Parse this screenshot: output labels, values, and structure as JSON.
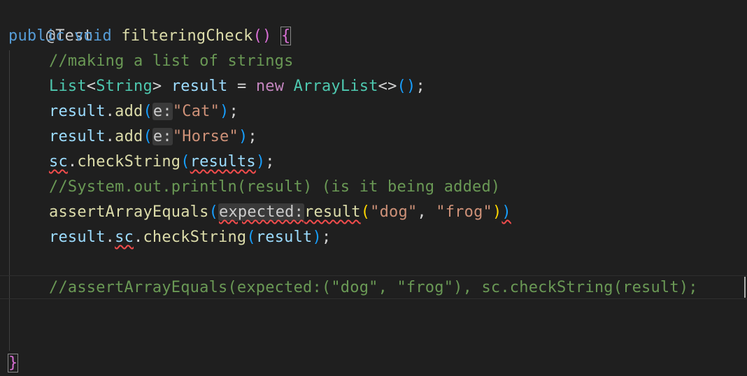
{
  "editor": {
    "lines": {
      "l1": {
        "annotation": "@Test"
      },
      "l2": {
        "kw_public": "public",
        "kw_void": "void",
        "method": "filteringCheck",
        "parens": "()",
        "brace_open": "{"
      },
      "l3": {
        "comment": "//making a list of strings"
      },
      "l4": {
        "type_list": "List",
        "lt": "<",
        "type_string": "String",
        "gt": ">",
        "var": "result",
        "eq": "=",
        "kw_new": "new",
        "type_arraylist": "ArrayList",
        "diamond": "<>",
        "call": "()",
        "semi": ";"
      },
      "l5": {
        "obj": "result",
        "dot": ".",
        "method": "add",
        "open": "(",
        "hint": "e:",
        "arg": "\"Cat\"",
        "close": ")",
        "semi": ";"
      },
      "l6": {
        "obj": "result",
        "dot": ".",
        "method": "add",
        "open": "(",
        "hint": "e:",
        "arg": "\"Horse\"",
        "close": ")",
        "semi": ";"
      },
      "l7": {
        "obj": "sc",
        "dot": ".",
        "method": "checkString",
        "open": "(",
        "arg": "results",
        "close": ")",
        "semi": ";"
      },
      "l8": {
        "comment": "//System.out.println(result) (is it being added)"
      },
      "l9": {
        "method": "assertArrayEquals",
        "open": "(",
        "hint": "expected:",
        "fn": "result",
        "open2": "(",
        "arg1": "\"dog\"",
        "comma": ", ",
        "arg2": "\"frog\"",
        "close2": ")",
        "close": ")"
      },
      "l10": {
        "obj": "result",
        "dot1": ".",
        "field": "sc",
        "dot2": ".",
        "method": "checkString",
        "open": "(",
        "arg": "result",
        "close": ")",
        "semi": ";"
      },
      "l12": {
        "comment": "//assertArrayEquals(expected:(\"dog\", \"frog\"), sc.checkString(result);"
      },
      "l15": {
        "brace_close": "}"
      }
    }
  }
}
